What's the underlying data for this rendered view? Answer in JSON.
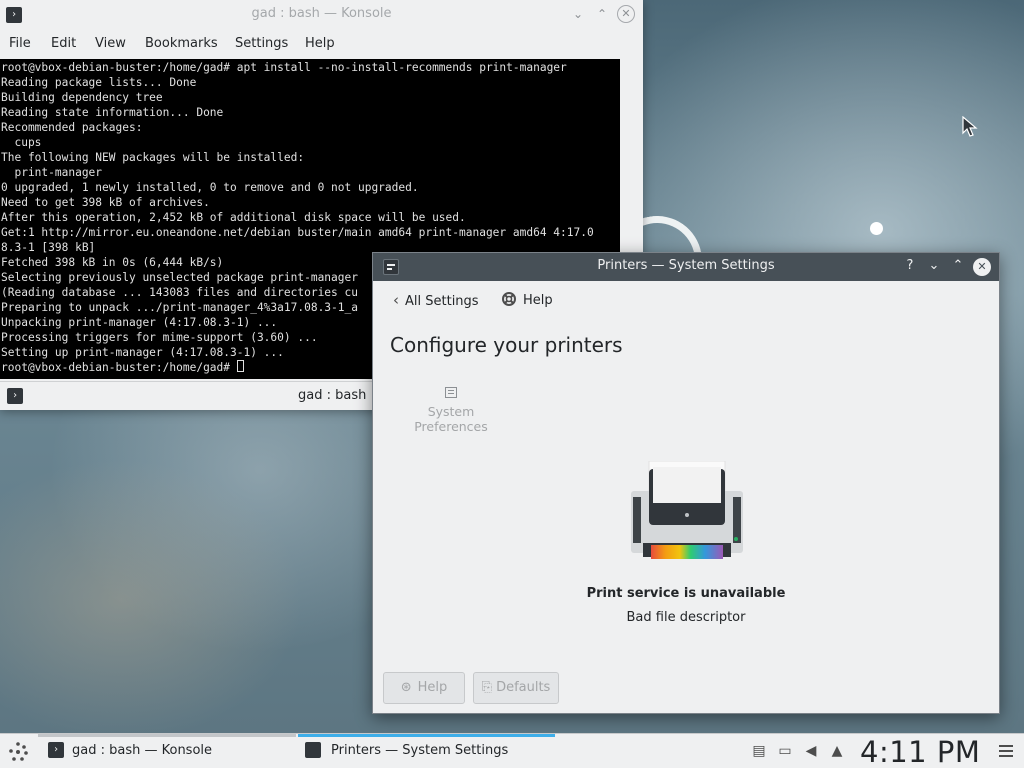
{
  "konsole": {
    "title": "gad : bash — Konsole",
    "menu": [
      "File",
      "Edit",
      "View",
      "Bookmarks",
      "Settings",
      "Help"
    ],
    "terminal_lines": [
      "root@vbox-debian-buster:/home/gad# apt install --no-install-recommends print-manager",
      "Reading package lists... Done",
      "Building dependency tree",
      "Reading state information... Done",
      "Recommended packages:",
      "  cups",
      "The following NEW packages will be installed:",
      "  print-manager",
      "0 upgraded, 1 newly installed, 0 to remove and 0 not upgraded.",
      "Need to get 398 kB of archives.",
      "After this operation, 2,452 kB of additional disk space will be used.",
      "Get:1 http://mirror.eu.oneandone.net/debian buster/main amd64 print-manager amd64 4:17.0",
      "8.3-1 [398 kB]",
      "Fetched 398 kB in 0s (6,444 kB/s)",
      "Selecting previously unselected package print-manager",
      "(Reading database ... 143083 files and directories cu",
      "Preparing to unpack .../print-manager_4%3a17.08.3-1_a",
      "Unpacking print-manager (4:17.08.3-1) ...",
      "Processing triggers for mime-support (3.60) ...",
      "Setting up print-manager (4:17.08.3-1) ...",
      "root@vbox-debian-buster:/home/gad# "
    ],
    "tab_label": "gad : bash"
  },
  "settings": {
    "title": "Printers — System Settings",
    "title_buttons": {
      "help": "?",
      "minimize": "⌄",
      "maximize": "⌃",
      "close": "✕"
    },
    "back_label": "All Settings",
    "help_label": "Help",
    "heading": "Configure your printers",
    "system_preferences": "System Preferences",
    "status_title": "Print service is unavailable",
    "status_detail": "Bad file descriptor",
    "footer_help": "Help",
    "footer_defaults": "Defaults"
  },
  "taskbar": {
    "tasks": [
      {
        "label": "gad : bash — Konsole",
        "active": false
      },
      {
        "label": "Printers  — System Settings",
        "active": true
      }
    ],
    "clock": "4:11 PM"
  },
  "colors": {
    "accent": "#3daee9",
    "titlebar_active": "#475057",
    "window_bg": "#eff0f1",
    "terminal_bg": "#000000"
  },
  "icons": {
    "launcher": "kde-application-launcher-icon",
    "tray": [
      "clipboard-icon",
      "network-icon",
      "volume-icon",
      "expand-tray-arrow-icon"
    ]
  }
}
